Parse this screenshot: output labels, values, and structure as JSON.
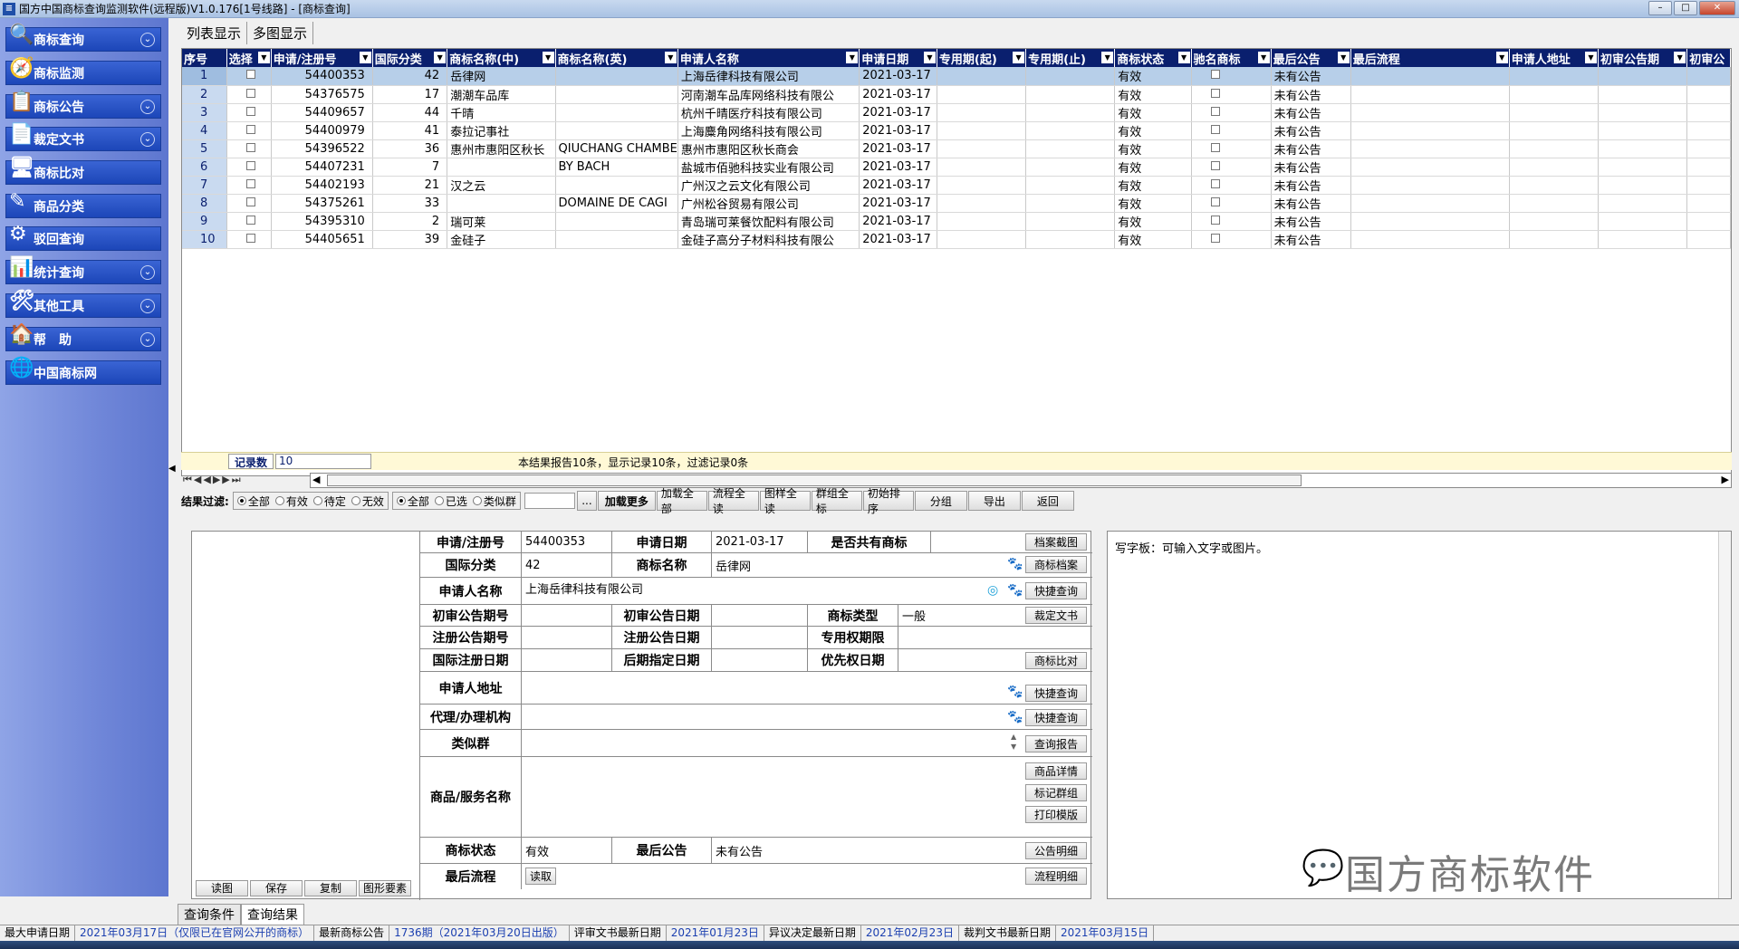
{
  "window": {
    "title": "国方中国商标查询监测软件(远程版)V1.0.176[1号线路] - [商标查询]",
    "min": "–",
    "max": "□",
    "close": "✕"
  },
  "sidebar": [
    {
      "label": "商标查询",
      "icon": "🔍",
      "chev": true
    },
    {
      "label": "商标监测",
      "icon": "🧭",
      "chev": false
    },
    {
      "label": "商标公告",
      "icon": "📋",
      "chev": true
    },
    {
      "label": "裁定文书",
      "icon": "📄",
      "chev": true
    },
    {
      "label": "商标比对",
      "icon": "🖥",
      "chev": false
    },
    {
      "label": "商品分类",
      "icon": "✎",
      "chev": false
    },
    {
      "label": "驳回查询",
      "icon": "⚙",
      "chev": false
    },
    {
      "label": "统计查询",
      "icon": "📊",
      "chev": true
    },
    {
      "label": "其他工具",
      "icon": "🛠",
      "chev": true
    },
    {
      "label": "帮　助",
      "icon": "🏠",
      "chev": true
    },
    {
      "label": "中国商标网",
      "icon": "🌐",
      "chev": false
    }
  ],
  "view_tabs": [
    "列表显示",
    "多图显示"
  ],
  "columns": [
    "序号",
    "选择",
    "申请/注册号",
    "国际分类",
    "商标名称(中)",
    "商标名称(英)",
    "申请人名称",
    "申请日期",
    "专用期(起)",
    "专用期(止)",
    "商标状态",
    "驰名商标",
    "最后公告",
    "最后流程",
    "申请人地址",
    "初审公告期",
    "初审公"
  ],
  "rows": [
    {
      "n": "1",
      "reg": "54400353",
      "cls": "42",
      "cn": "岳律网",
      "en": "",
      "app": "上海岳律科技有限公司",
      "date": "2021-03-17",
      "status": "有效",
      "notice": "未有公告"
    },
    {
      "n": "2",
      "reg": "54376575",
      "cls": "17",
      "cn": "潮潮车品库",
      "en": "",
      "app": "河南潮车品库网络科技有限公",
      "date": "2021-03-17",
      "status": "有效",
      "notice": "未有公告"
    },
    {
      "n": "3",
      "reg": "54409657",
      "cls": "44",
      "cn": "千晴",
      "en": "",
      "app": "杭州千晴医疗科技有限公司",
      "date": "2021-03-17",
      "status": "有效",
      "notice": "未有公告"
    },
    {
      "n": "4",
      "reg": "54400979",
      "cls": "41",
      "cn": "泰拉记事社",
      "en": "",
      "app": "上海麋角网络科技有限公司",
      "date": "2021-03-17",
      "status": "有效",
      "notice": "未有公告"
    },
    {
      "n": "5",
      "reg": "54396522",
      "cls": "36",
      "cn": "惠州市惠阳区秋长",
      "en": "QIUCHANG CHAMBE",
      "app": "惠州市惠阳区秋长商会",
      "date": "2021-03-17",
      "status": "有效",
      "notice": "未有公告"
    },
    {
      "n": "6",
      "reg": "54407231",
      "cls": "7",
      "cn": "",
      "en": "BY BACH",
      "app": "盐城市佰驰科技实业有限公司",
      "date": "2021-03-17",
      "status": "有效",
      "notice": "未有公告"
    },
    {
      "n": "7",
      "reg": "54402193",
      "cls": "21",
      "cn": "汉之云",
      "en": "",
      "app": "广州汉之云文化有限公司",
      "date": "2021-03-17",
      "status": "有效",
      "notice": "未有公告"
    },
    {
      "n": "8",
      "reg": "54375261",
      "cls": "33",
      "cn": "",
      "en": "DOMAINE DE CAGI",
      "app": "广州松谷贸易有限公司",
      "date": "2021-03-17",
      "status": "有效",
      "notice": "未有公告"
    },
    {
      "n": "9",
      "reg": "54395310",
      "cls": "2",
      "cn": "瑞可莱",
      "en": "",
      "app": "青岛瑞可莱餐饮配料有限公司",
      "date": "2021-03-17",
      "status": "有效",
      "notice": "未有公告"
    },
    {
      "n": "10",
      "reg": "54405651",
      "cls": "39",
      "cn": "金硅子",
      "en": "",
      "app": "金硅子高分子材料科技有限公",
      "date": "2021-03-17",
      "status": "有效",
      "notice": "未有公告"
    }
  ],
  "summary": {
    "label": "记录数",
    "count": "10",
    "text": "本结果报告10条，显示记录10条，过滤记录0条"
  },
  "filter": {
    "label": "结果过滤:",
    "group1": [
      "全部",
      "有效",
      "待定",
      "无效"
    ],
    "group2": [
      "全部",
      "已选",
      "类似群"
    ],
    "ellipsis": "...",
    "buttons": [
      "加载更多",
      "加载全部",
      "流程全读",
      "图样全读",
      "群组全标",
      "初始排序",
      "分组",
      "导出",
      "返回"
    ]
  },
  "detail": {
    "reg_label": "申请/注册号",
    "reg": "54400353",
    "date_label": "申请日期",
    "date": "2021-03-17",
    "shared_label": "是否共有商标",
    "cls_label": "国际分类",
    "cls": "42",
    "name_label": "商标名称",
    "name": "岳律网",
    "app_label": "申请人名称",
    "app": "上海岳律科技有限公司",
    "prelim_no_label": "初审公告期号",
    "prelim_date_label": "初审公告日期",
    "type_label": "商标类型",
    "type": "一般",
    "reg_no_label": "注册公告期号",
    "reg_date_label": "注册公告日期",
    "period_label": "专用权期限",
    "intl_label": "国际注册日期",
    "later_label": "后期指定日期",
    "priority_label": "优先权日期",
    "addr_label": "申请人地址",
    "agent_label": "代理/办理机构",
    "similar_label": "类似群",
    "goods_label": "商品/服务名称",
    "status_label": "商标状态",
    "status": "有效",
    "last_notice_label": "最后公告",
    "last_notice": "未有公告",
    "last_flow_label": "最后流程",
    "read": "读取",
    "btn_archive_img": "档案截图",
    "btn_archive": "商标档案",
    "btn_quick": "快捷查询",
    "btn_ruling": "裁定文书",
    "btn_compare": "商标比对",
    "btn_report": "查询报告",
    "btn_goods": "商品详情",
    "btn_group": "标记群组",
    "btn_print": "打印模版",
    "btn_notice": "公告明细",
    "btn_flow": "流程明细"
  },
  "image_buttons": [
    "读图",
    "保存",
    "复制",
    "图形要素"
  ],
  "writepad": "写字板：可输入文字或图片。",
  "watermark": "国方商标软件",
  "bottom_tabs": [
    "查询条件",
    "查询结果"
  ],
  "status": [
    {
      "k": "最大申请日期",
      "v": "2021年03月17日（仅限已在官网公开的商标）"
    },
    {
      "k": "最新商标公告",
      "v": "1736期（2021年03月20日出版）"
    },
    {
      "k": "评审文书最新日期",
      "v": "2021年01月23日"
    },
    {
      "k": "异议决定最新日期",
      "v": "2021年02月23日"
    },
    {
      "k": "裁判文书最新日期",
      "v": "2021年03月15日"
    }
  ]
}
